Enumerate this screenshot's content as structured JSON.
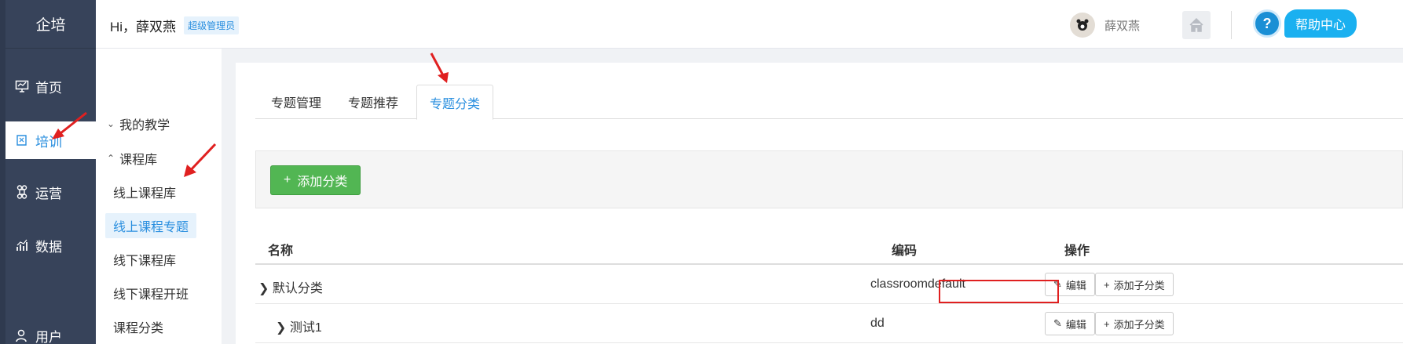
{
  "brand": "企培",
  "rail": [
    {
      "label": "首页",
      "icon": "monitor-icon"
    },
    {
      "label": "培训",
      "icon": "book-icon",
      "active": true
    },
    {
      "label": "运营",
      "icon": "command-icon"
    },
    {
      "label": "数据",
      "icon": "bar-chart-icon"
    },
    {
      "label": "用户",
      "icon": "user-icon"
    }
  ],
  "header": {
    "greeting": "Hi，薛双燕",
    "role": "超级管理员",
    "username": "薛双燕",
    "help": "帮助中心"
  },
  "subnav": {
    "groups": [
      {
        "label": "我的教学",
        "expanded": false
      },
      {
        "label": "课程库",
        "expanded": true
      }
    ],
    "items": [
      "线上课程库",
      "线上课程专题",
      "线下课程库",
      "线下课程开班",
      "课程分类"
    ]
  },
  "tabs": [
    "专题管理",
    "专题推荐",
    "专题分类"
  ],
  "toolbar": {
    "add_label": "添加分类"
  },
  "table": {
    "headers": [
      "名称",
      "编码",
      "操作"
    ],
    "rows": [
      {
        "name": "默认分类",
        "code": "classroomdefault"
      },
      {
        "name": "测试1",
        "code": "dd"
      }
    ],
    "edit_label": "编辑",
    "add_child_label": "添加子分类"
  },
  "colors": {
    "accent": "#2a8fdf",
    "rail": "#37435a",
    "success": "#52b653",
    "annotation": "#e02020"
  }
}
